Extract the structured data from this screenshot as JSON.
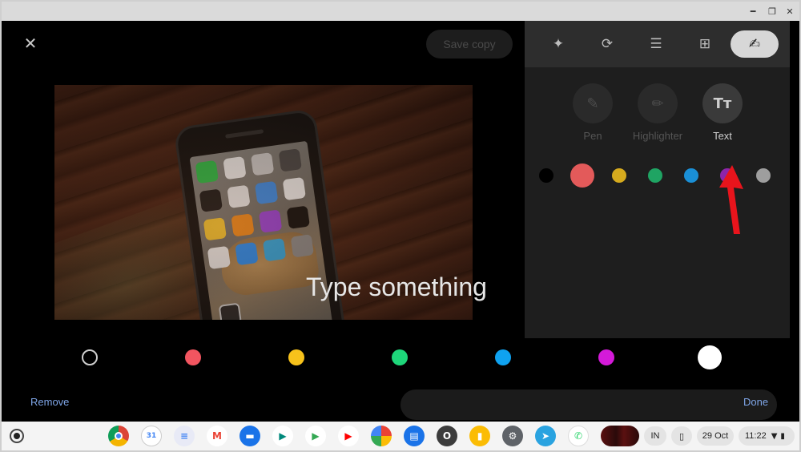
{
  "window": {
    "minimize_icon": "minimize-icon",
    "restore_icon": "restore-icon",
    "close_icon": "close-icon"
  },
  "editor": {
    "save_copy_label": "Save copy",
    "photo_text": "Type something",
    "remove_label": "Remove",
    "done_label": "Done",
    "tabs": [
      {
        "name": "auto-enhance",
        "glyph": "✦"
      },
      {
        "name": "crop-rotate",
        "glyph": "⟳"
      },
      {
        "name": "adjust",
        "glyph": "☰"
      },
      {
        "name": "filters",
        "glyph": "⊞"
      },
      {
        "name": "markup",
        "glyph": "✍"
      }
    ],
    "tools": [
      {
        "label": "Pen",
        "glyph": "✎"
      },
      {
        "label": "Highlighter",
        "glyph": "✏"
      },
      {
        "label": "Text",
        "glyph": "Tт"
      }
    ],
    "panel_colors": [
      "#000000",
      "#e35a5a",
      "#d6ab1e",
      "#1fa463",
      "#1a8fd6",
      "#8e24aa",
      "#9e9e9e"
    ],
    "text_colors": [
      "outline",
      "#f25560",
      "#f7c21b",
      "#1ed67a",
      "#0fa2f0",
      "#d41ad9",
      "#ffffff"
    ],
    "selected_panel_color": "#e35a5a",
    "selected_text_color": "#ffffff"
  },
  "shelf": {
    "apps": [
      "Chrome",
      "Calendar",
      "Docs",
      "Gmail",
      "Files",
      "Meet",
      "Play Store",
      "YouTube",
      "Photos",
      "Messages",
      "O",
      "Keep",
      "Settings",
      "Telegram",
      "WhatsApp"
    ],
    "input_method": "IN",
    "date": "29 Oct",
    "time": "11:22"
  }
}
